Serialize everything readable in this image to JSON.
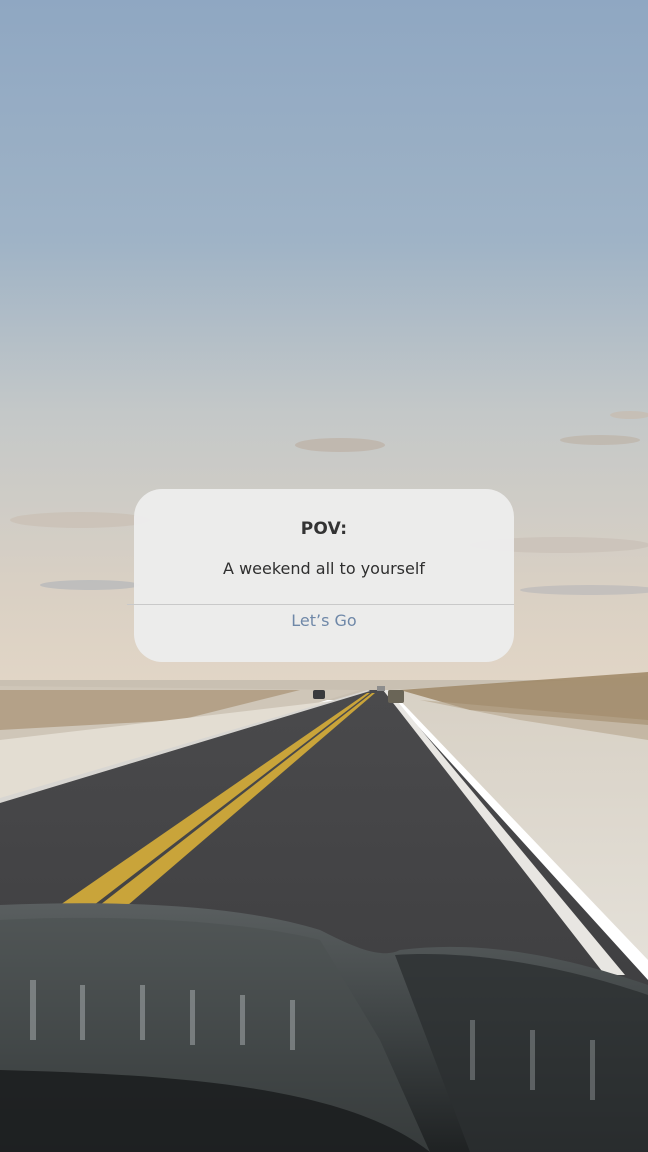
{
  "dialog": {
    "title": "POV:",
    "message": "A weekend all to yourself",
    "action_label": "Let’s Go"
  },
  "colors": {
    "dialog_background": "#ececec",
    "title_text": "#333333",
    "message_text": "#2f2f2f",
    "action_text": "#6f88a8",
    "divider": "#c9c9c9"
  },
  "background": {
    "icon": "road-at-dusk-photo"
  }
}
